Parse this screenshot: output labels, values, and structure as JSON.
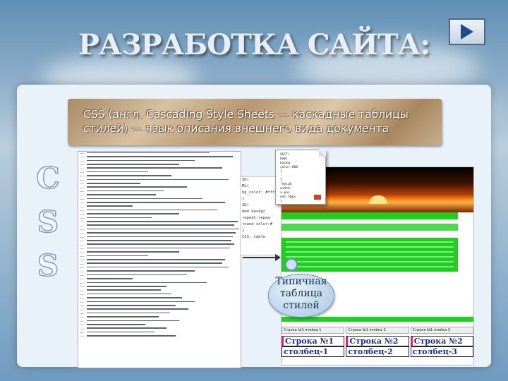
{
  "slide": {
    "title": "РАЗРАБОТКА САЙТА:",
    "next_button": "next-slide",
    "css_letters": [
      "C",
      "S",
      "S"
    ],
    "banner_text": "CSS (англ. Cascading Style Sheets — каскадные таблицы стилей) — язык описания внешнего вида документа",
    "callout_text": [
      "Типичная",
      "таблица",
      "стилей"
    ]
  },
  "mid_snippet": [
    "SD(",
    "ML(",
    "bg_color: #ffffe",
    "}",
    "SD(",
    "bmd backgr",
    "repeat:repea",
    "round color:#",
    "}",
    "CSS. table"
  ],
  "popup_lines": [
    "SECT(",
    "bmm(",
    " backg",
    " color:#00",
    "}",
    " - ",
    "t",
    "'heigh",
    " width:",
    "x-pos",
    " eds:50px",
    "}"
  ],
  "table": {
    "headers": [
      "Строка №1 ячейка 1",
      "Строка №1 ячейка 2",
      "Строка №1 ячейка 3"
    ],
    "cells": [
      [
        "Строка №1",
        "Строка №2",
        "Строка №2"
      ],
      [
        "столбец-1",
        "столбец-2",
        "столбец-3"
      ]
    ]
  },
  "colors": {
    "panel": "#e9f2f9",
    "banner": "#b79770",
    "green": "#22cc22",
    "nav_arrow": "#1f4c86"
  }
}
